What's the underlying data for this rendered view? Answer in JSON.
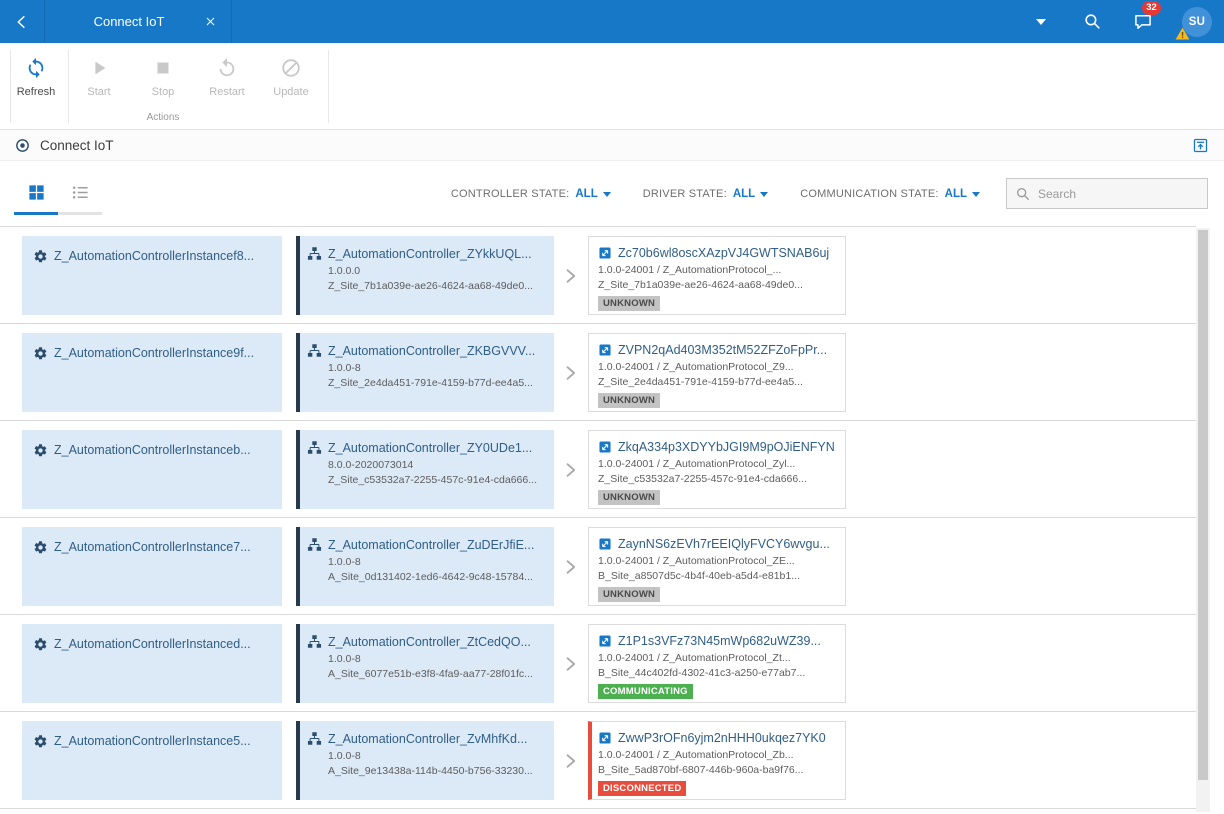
{
  "topbar": {
    "tab_title": "Connect IoT",
    "notification_count": "32",
    "avatar_initials": "SU"
  },
  "toolbar": {
    "buttons": {
      "refresh": "Refresh",
      "start": "Start",
      "stop": "Stop",
      "restart": "Restart",
      "update": "Update"
    },
    "group_label": "Actions"
  },
  "page_header": {
    "title": "Connect IoT"
  },
  "filters": {
    "controller_state_label": "CONTROLLER STATE:",
    "controller_state_value": "ALL",
    "driver_state_label": "DRIVER STATE:",
    "driver_state_value": "ALL",
    "communication_state_label": "COMMUNICATION STATE:",
    "communication_state_value": "ALL",
    "search_placeholder": "Search"
  },
  "colors": {
    "accent": "#1878c8",
    "status_unknown": "#c3c3c3",
    "status_communicating": "#4caf50",
    "status_disconnected": "#e74c3c"
  },
  "rows": [
    {
      "instance_name": "Z_AutomationControllerInstancef8...",
      "controller": {
        "name": "Z_AutomationController_ZYkkUQL...",
        "version": "1.0.0.0",
        "site": "Z_Site_7b1a039e-ae26-4624-aa68-49de0..."
      },
      "driver": {
        "name": "Zc70b6wl8oscXAzpVJ4GWTSNAB6uj",
        "version_line": "1.0.0-24001 / Z_AutomationProtocol_...",
        "site": "Z_Site_7b1a039e-ae26-4624-aa68-49de0...",
        "status": "UNKNOWN",
        "status_type": "unknown"
      }
    },
    {
      "instance_name": "Z_AutomationControllerInstance9f...",
      "controller": {
        "name": "Z_AutomationController_ZKBGVVV...",
        "version": "1.0.0-8",
        "site": "Z_Site_2e4da451-791e-4159-b77d-ee4a5..."
      },
      "driver": {
        "name": "ZVPN2qAd403M352tM52ZFZoFpPr...",
        "version_line": "1.0.0-24001 / Z_AutomationProtocol_Z9...",
        "site": "Z_Site_2e4da451-791e-4159-b77d-ee4a5...",
        "status": "UNKNOWN",
        "status_type": "unknown"
      }
    },
    {
      "instance_name": "Z_AutomationControllerInstanceb...",
      "controller": {
        "name": "Z_AutomationController_ZY0UDe1...",
        "version": "8.0.0-2020073014",
        "site": "Z_Site_c53532a7-2255-457c-91e4-cda666..."
      },
      "driver": {
        "name": "ZkqA334p3XDYYbJGI9M9pOJiENFYN",
        "version_line": "1.0.0-24001 / Z_AutomationProtocol_Zyl...",
        "site": "Z_Site_c53532a7-2255-457c-91e4-cda666...",
        "status": "UNKNOWN",
        "status_type": "unknown"
      }
    },
    {
      "instance_name": "Z_AutomationControllerInstance7...",
      "controller": {
        "name": "Z_AutomationController_ZuDErJfiE...",
        "version": "1.0.0-8",
        "site": "A_Site_0d131402-1ed6-4642-9c48-15784..."
      },
      "driver": {
        "name": "ZaynNS6zEVh7rEEIQlyFVCY6wvgu...",
        "version_line": "1.0.0-24001 / Z_AutomationProtocol_ZE...",
        "site": "B_Site_a8507d5c-4b4f-40eb-a5d4-e81b1...",
        "status": "UNKNOWN",
        "status_type": "unknown"
      }
    },
    {
      "instance_name": "Z_AutomationControllerInstanced...",
      "controller": {
        "name": "Z_AutomationController_ZtCedQO...",
        "version": "1.0.0-8",
        "site": "A_Site_6077e51b-e3f8-4fa9-aa77-28f01fc..."
      },
      "driver": {
        "name": "Z1P1s3VFz73N45mWp682uWZ39...",
        "version_line": "1.0.0-24001 / Z_AutomationProtocol_Zt...",
        "site": "B_Site_44c402fd-4302-41c3-a250-e77ab7...",
        "status": "COMMUNICATING",
        "status_type": "communicating"
      }
    },
    {
      "instance_name": "Z_AutomationControllerInstance5...",
      "controller": {
        "name": "Z_AutomationController_ZvMhfKd...",
        "version": "1.0.0-8",
        "site": "A_Site_9e13438a-114b-4450-b756-33230..."
      },
      "driver": {
        "name": "ZwwP3rOFn6yjm2nHHH0ukqez7YK0",
        "version_line": "1.0.0-24001 / Z_AutomationProtocol_Zb...",
        "site": "B_Site_5ad870bf-6807-446b-960a-ba9f76...",
        "status": "DISCONNECTED",
        "status_type": "disconnected"
      }
    }
  ]
}
